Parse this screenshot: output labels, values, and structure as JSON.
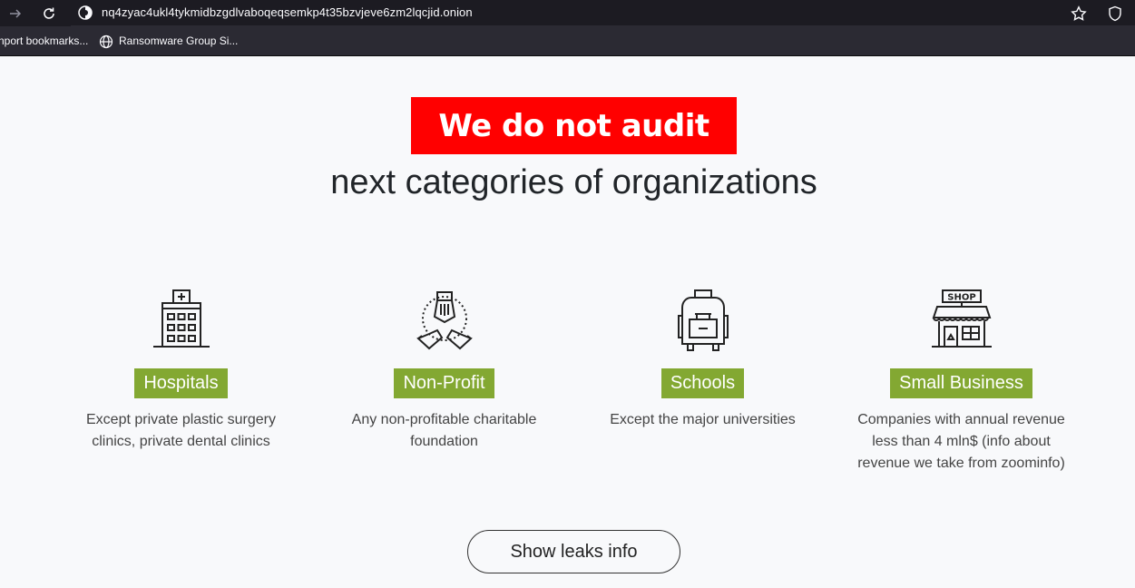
{
  "browser": {
    "url": "nq4zyac4ukl4tykmidbzgdlvaboqeqsemkp4t35bzvjeve6zm2lqcjid.onion",
    "bookmarks": [
      {
        "label": "nport bookmarks..."
      },
      {
        "label": "Ransomware Group Si..."
      }
    ]
  },
  "hero": {
    "headline": "We do not audit",
    "subhead": "next categories of organizations",
    "headline_bg": "#ff0000"
  },
  "categories": [
    {
      "icon": "hospital-icon",
      "label": "Hospitals",
      "desc_lines": [
        "Except private plastic surgery",
        "clinics, private dental clinics"
      ]
    },
    {
      "icon": "charity-hands-icon",
      "label": "Non-Profit",
      "desc_lines": [
        "Any non-profitable charitable",
        "foundation"
      ]
    },
    {
      "icon": "backpack-icon",
      "label": "Schools",
      "desc_lines": [
        "Except the major universities"
      ]
    },
    {
      "icon": "shop-icon",
      "label": "Small Business",
      "desc_lines": [
        "Companies with annual revenue",
        "less than 4 mln$ (info about",
        "revenue we take from zoominfo)"
      ]
    }
  ],
  "shop_sign": "SHOP",
  "label_color": "#83a832",
  "cta": {
    "label": "Show leaks info"
  }
}
